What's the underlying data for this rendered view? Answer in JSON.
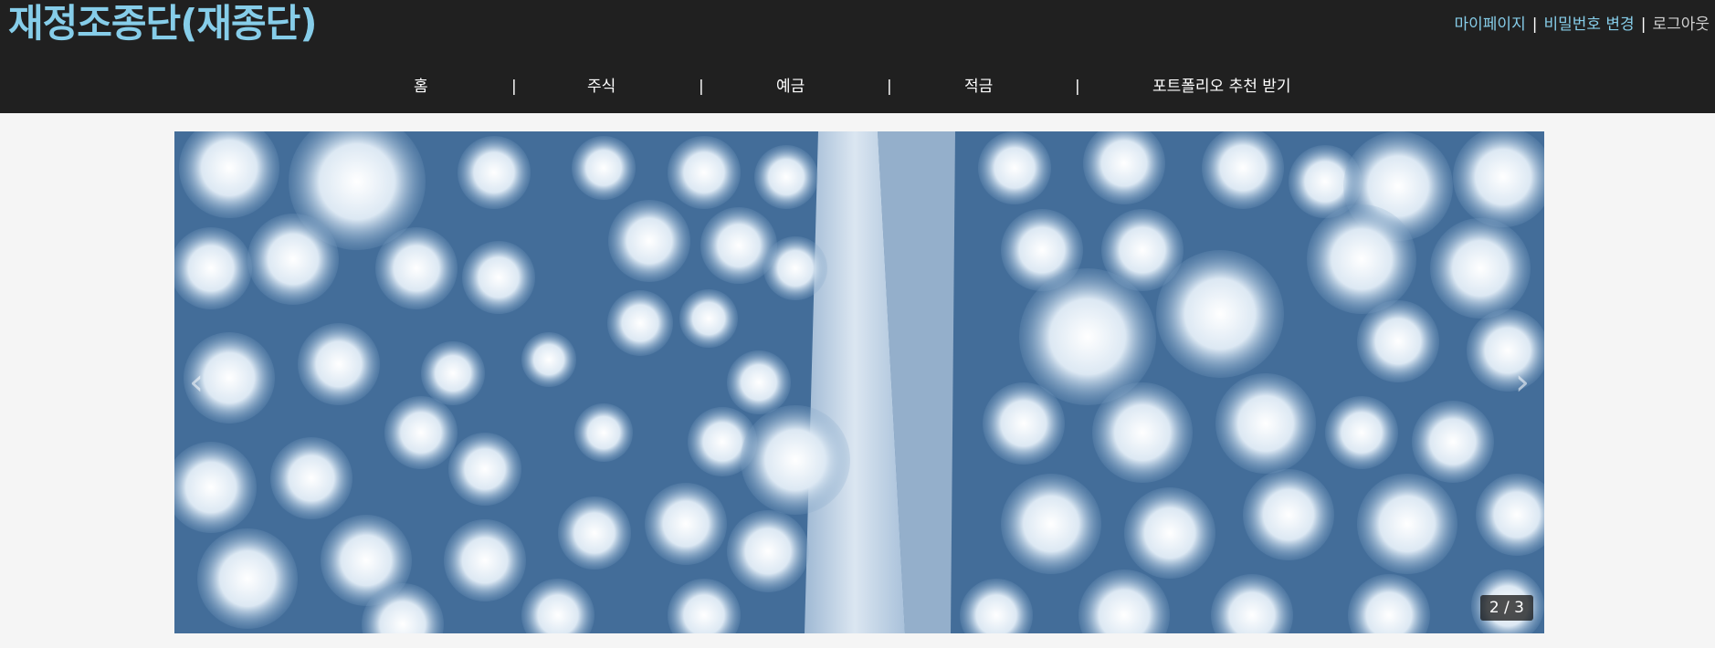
{
  "header": {
    "site_title": "재정조종단(재종단)",
    "user_links": {
      "mypage": "마이페이지",
      "separator": "|",
      "change_password": "비밀번호 변경",
      "logout": "로그아웃"
    }
  },
  "nav": {
    "items": [
      "홈",
      "주식",
      "예금",
      "적금",
      "포트폴리오 추천 받기"
    ],
    "separator": "|"
  },
  "carousel": {
    "prev_arrow": "‹",
    "next_arrow": "›",
    "counter": "2 / 3"
  },
  "colors": {
    "header_bg": "#202020",
    "title": "#86cde9",
    "link_blue": "#86cde9",
    "body_bg": "#f5f5f5"
  }
}
